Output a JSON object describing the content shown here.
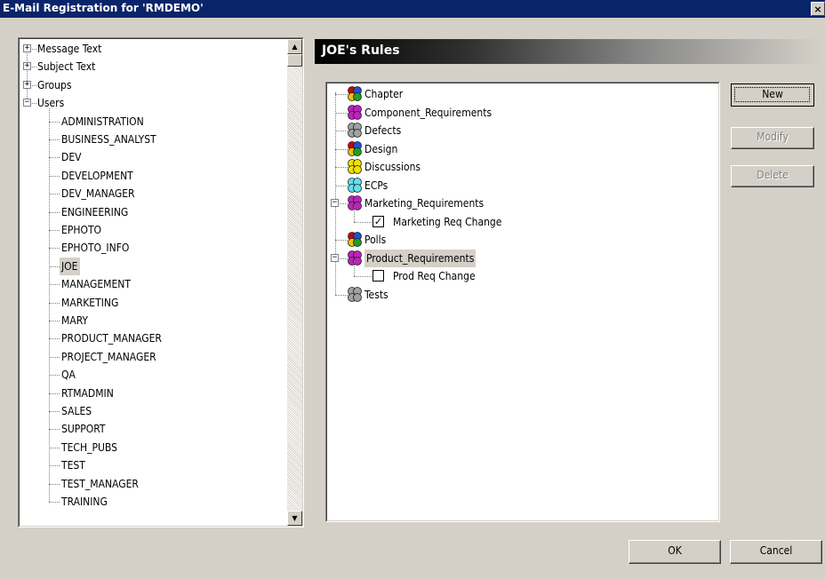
{
  "window": {
    "title": "E-Mail Registration for 'RMDEMO'",
    "close_glyph": "×"
  },
  "left_tree": {
    "top_items": [
      {
        "label": "Message Text",
        "expander": "+"
      },
      {
        "label": "Subject Text",
        "expander": "+"
      },
      {
        "label": "Groups",
        "expander": "+"
      },
      {
        "label": "Users",
        "expander": "−"
      }
    ],
    "users": [
      "ADMINISTRATION",
      "BUSINESS_ANALYST",
      "DEV",
      "DEVELOPMENT",
      "DEV_MANAGER",
      "ENGINEERING",
      "EPHOTO",
      "EPHOTO_INFO",
      "JOE",
      "MANAGEMENT",
      "MARKETING",
      "MARY",
      "PRODUCT_MANAGER",
      "PROJECT_MANAGER",
      "QA",
      "RTMADMIN",
      "SALES",
      "SUPPORT",
      "TECH_PUBS",
      "TEST",
      "TEST_MANAGER",
      "TRAINING"
    ],
    "selected_user": "JOE"
  },
  "rules": {
    "header": "JOE's Rules",
    "items": [
      {
        "label": "Chapter",
        "icon": "class-icon",
        "colors": [
          "#d00000",
          "#2050d0",
          "#f0c000",
          "#20a020"
        ]
      },
      {
        "label": "Component_Requirements",
        "icon": "class-icon",
        "colors": [
          "#c020c0",
          "#c020c0",
          "#c020c0",
          "#c020c0"
        ]
      },
      {
        "label": "Defects",
        "icon": "class-icon",
        "colors": [
          "#a0a0a0",
          "#a0a0a0",
          "#a0a0a0",
          "#a0a0a0"
        ]
      },
      {
        "label": "Design",
        "icon": "class-icon",
        "colors": [
          "#d00000",
          "#2050d0",
          "#f0c000",
          "#20a020"
        ]
      },
      {
        "label": "Discussions",
        "icon": "class-icon",
        "colors": [
          "#f0e000",
          "#f0e000",
          "#f0e000",
          "#f0e000"
        ]
      },
      {
        "label": "ECPs",
        "icon": "class-icon",
        "colors": [
          "#60e0f0",
          "#60e0f0",
          "#60e0f0",
          "#60e0f0"
        ]
      },
      {
        "label": "Marketing_Requirements",
        "icon": "class-icon",
        "colors": [
          "#c020c0",
          "#c020c0",
          "#c020c0",
          "#c020c0"
        ],
        "expander": "−"
      },
      {
        "label": "Marketing Req Change",
        "child": true,
        "checked": true
      },
      {
        "label": "Polls",
        "icon": "class-icon",
        "colors": [
          "#d00000",
          "#2050d0",
          "#f0c000",
          "#20a020"
        ]
      },
      {
        "label": "Product_Requirements",
        "icon": "class-icon",
        "colors": [
          "#c020c0",
          "#c020c0",
          "#c020c0",
          "#c020c0"
        ],
        "expander": "−",
        "selected": true
      },
      {
        "label": "Prod Req Change",
        "child": true,
        "checked": false
      },
      {
        "label": "Tests",
        "icon": "class-icon",
        "colors": [
          "#a0a0a0",
          "#a0a0a0",
          "#a0a0a0",
          "#a0a0a0"
        ]
      }
    ]
  },
  "buttons": {
    "new": "New",
    "modify": "Modify",
    "delete": "Delete",
    "ok": "OK",
    "cancel": "Cancel"
  },
  "check_glyph": "✓",
  "scroll": {
    "up": "▲",
    "down": "▼"
  }
}
